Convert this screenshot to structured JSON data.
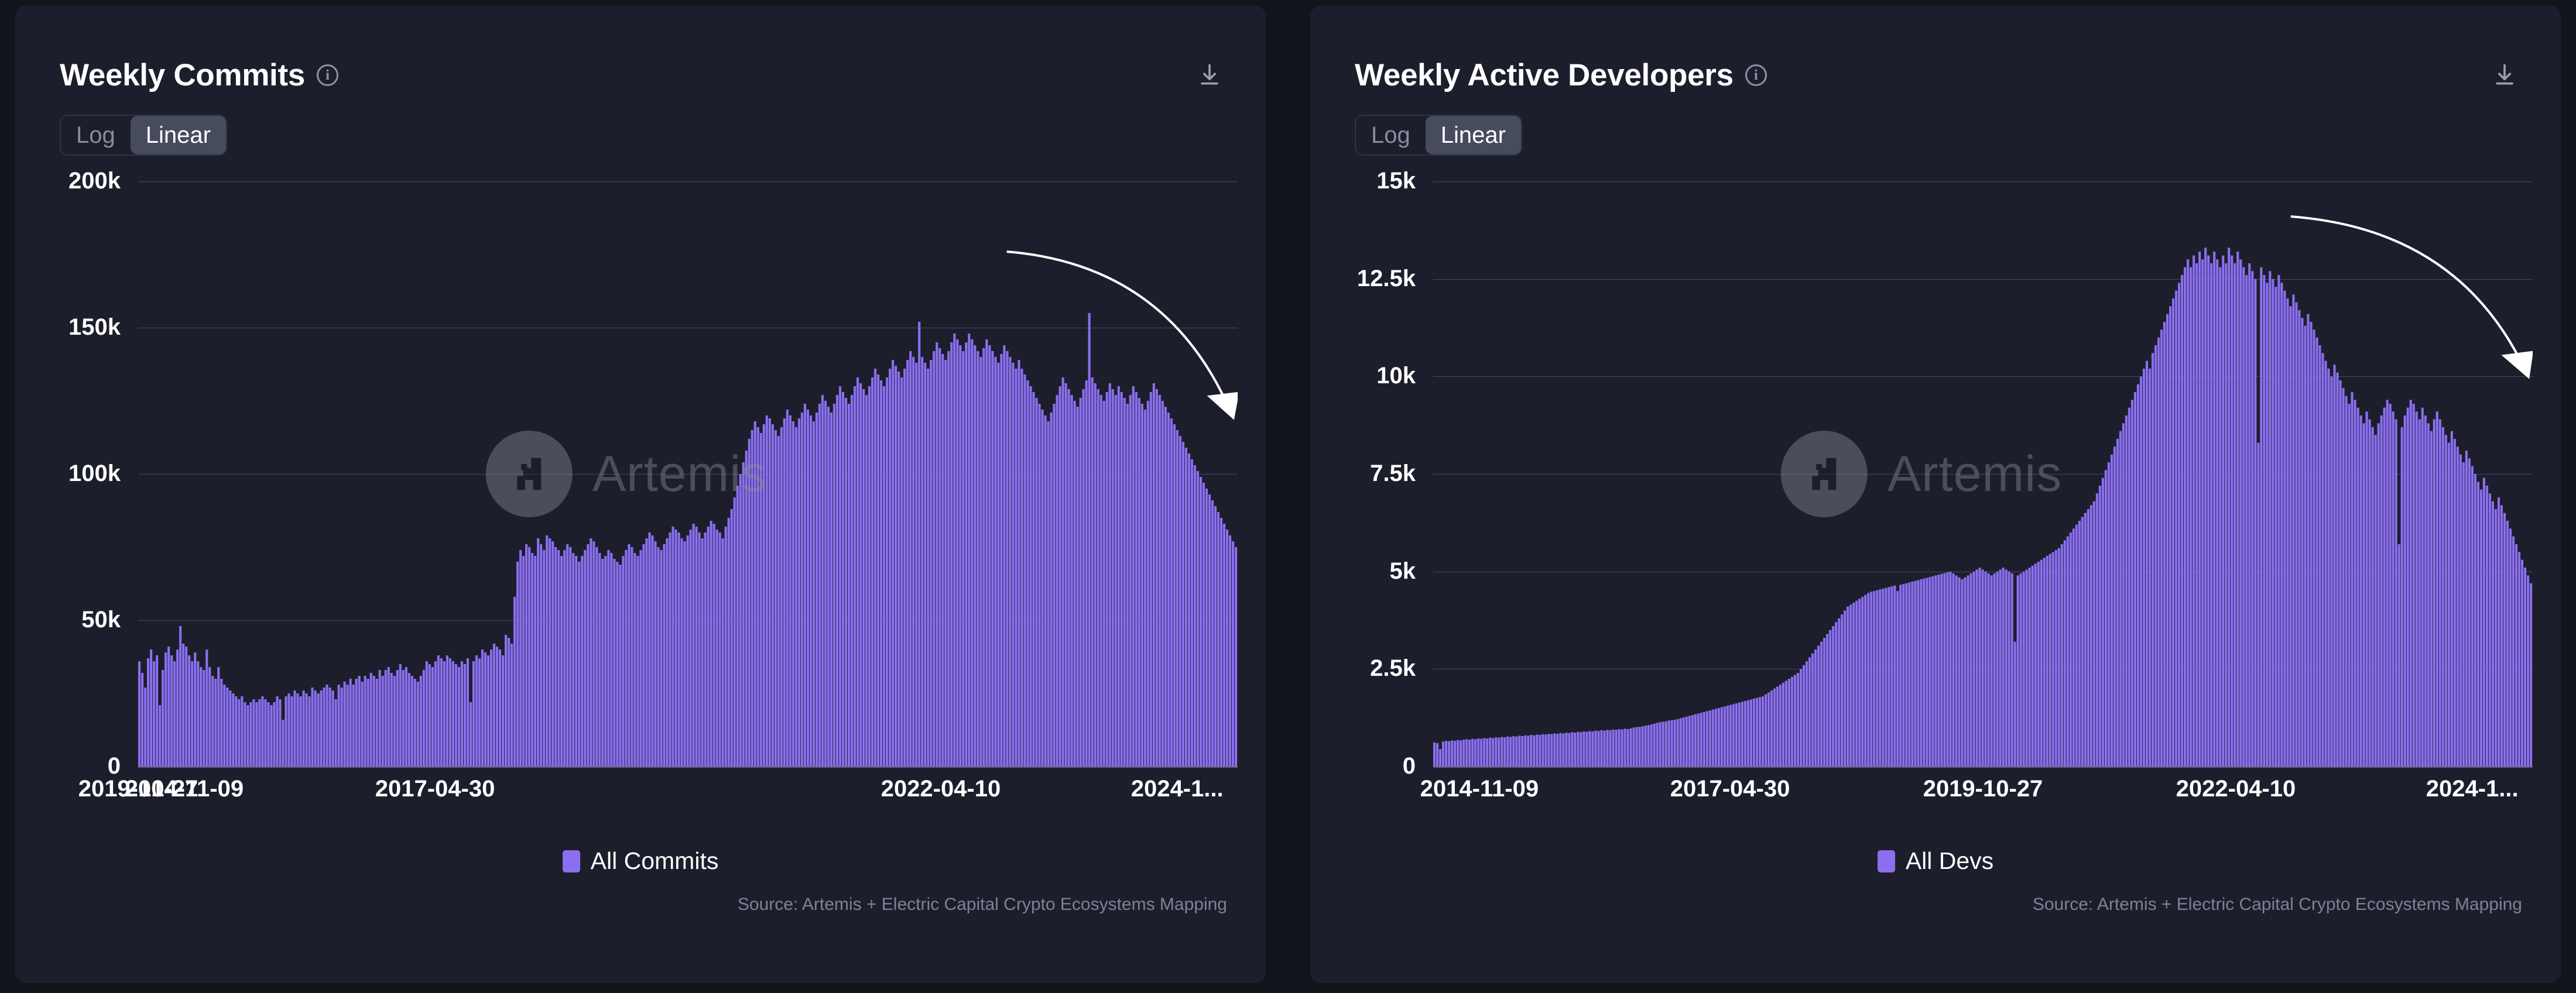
{
  "theme": {
    "page_bg": "#12141c",
    "panel_bg": "#1c1f2b",
    "bar_color": "#8b6ff0",
    "grid_color": "#434a5e",
    "text_primary": "#ffffff",
    "text_muted": "#868d9e",
    "annotation_color": "#ffffff"
  },
  "panels": [
    {
      "title": "Weekly Commits",
      "info_icon": "info-icon",
      "download_icon": "download-icon",
      "scale_toggle": {
        "options": [
          "Log",
          "Linear"
        ],
        "selected": "Linear"
      },
      "watermark": {
        "text": "Artemis",
        "logo": "artemis-logo-icon"
      },
      "legend": [
        {
          "label": "All Commits",
          "color": "#8b6ff0"
        }
      ],
      "source": "Source: Artemis + Electric Capital Crypto Ecosystems Mapping"
    },
    {
      "title": "Weekly Active Developers",
      "info_icon": "info-icon",
      "download_icon": "download-icon",
      "scale_toggle": {
        "options": [
          "Log",
          "Linear"
        ],
        "selected": "Linear"
      },
      "watermark": {
        "text": "Artemis",
        "logo": "artemis-logo-icon"
      },
      "legend": [
        {
          "label": "All Devs",
          "color": "#8b6ff0"
        }
      ],
      "source": "Source: Artemis + Electric Capital Crypto Ecosystems Mapping"
    }
  ],
  "chart_data": [
    {
      "type": "bar",
      "title": "Weekly Commits",
      "xlabel": "",
      "ylabel": "",
      "scale": "linear",
      "grid": true,
      "legend_position": "bottom",
      "series": [
        {
          "name": "All Commits",
          "color": "#8b6ff0"
        }
      ],
      "ylim": [
        0,
        200000
      ],
      "yticks": [
        0,
        50000,
        100000,
        150000,
        200000
      ],
      "ytick_labels": [
        "0",
        "50k",
        "100k",
        "150k",
        "200k"
      ],
      "xticks": [
        "2014-11-09",
        "2017-04-30",
        "2019-10-27",
        "2022-04-10",
        "2024-1..."
      ],
      "xtick_positions_pct": [
        0,
        25.0,
        50.0,
        75.0,
        98.0
      ],
      "x_start": "2014-11-09",
      "x_end": "2024-1...",
      "annotation": {
        "type": "curved-arrow",
        "from_pct": [
          79,
          12
        ],
        "to_pct": [
          99.5,
          40
        ]
      },
      "values": [
        36000,
        32000,
        27000,
        37000,
        40000,
        36000,
        38000,
        21000,
        33000,
        39000,
        41000,
        38000,
        36000,
        40000,
        48000,
        42000,
        41000,
        38000,
        36000,
        39000,
        36000,
        34000,
        33000,
        40000,
        34000,
        31000,
        30000,
        34000,
        30000,
        28000,
        27000,
        26000,
        25000,
        24000,
        23000,
        24000,
        22000,
        21000,
        22000,
        23000,
        22000,
        23000,
        24000,
        23000,
        22000,
        21000,
        22000,
        24000,
        23000,
        16000,
        24000,
        25000,
        24000,
        26000,
        25000,
        24000,
        26000,
        25000,
        24000,
        27000,
        26000,
        25000,
        26000,
        27000,
        28000,
        27000,
        26000,
        23000,
        28000,
        27000,
        29000,
        28000,
        30000,
        28000,
        30000,
        31000,
        29000,
        31000,
        30000,
        32000,
        31000,
        30000,
        33000,
        31000,
        33000,
        34000,
        32000,
        31000,
        33000,
        35000,
        33000,
        34000,
        32000,
        31000,
        30000,
        29000,
        31000,
        33000,
        36000,
        35000,
        34000,
        36000,
        38000,
        37000,
        36000,
        38000,
        37000,
        36000,
        35000,
        34000,
        36000,
        35000,
        37000,
        22000,
        36000,
        38000,
        37000,
        40000,
        39000,
        38000,
        40000,
        42000,
        41000,
        40000,
        38000,
        45000,
        44000,
        42000,
        58000,
        70000,
        74000,
        72000,
        76000,
        75000,
        73000,
        72000,
        78000,
        76000,
        74000,
        79000,
        78000,
        77000,
        75000,
        74000,
        72000,
        74000,
        76000,
        75000,
        73000,
        72000,
        70000,
        72000,
        74000,
        76000,
        78000,
        77000,
        75000,
        73000,
        71000,
        72000,
        74000,
        73000,
        71000,
        70000,
        69000,
        72000,
        74000,
        76000,
        75000,
        73000,
        72000,
        74000,
        76000,
        78000,
        80000,
        79000,
        77000,
        75000,
        74000,
        76000,
        78000,
        80000,
        82000,
        81000,
        80000,
        78000,
        77000,
        79000,
        81000,
        83000,
        82000,
        80000,
        78000,
        80000,
        82000,
        84000,
        83000,
        81000,
        80000,
        78000,
        82000,
        85000,
        88000,
        92000,
        96000,
        100000,
        104000,
        108000,
        112000,
        115000,
        118000,
        116000,
        114000,
        117000,
        120000,
        119000,
        117000,
        115000,
        113000,
        116000,
        119000,
        122000,
        120000,
        118000,
        116000,
        119000,
        121000,
        124000,
        122000,
        120000,
        118000,
        121000,
        124000,
        127000,
        125000,
        123000,
        121000,
        124000,
        127000,
        130000,
        128000,
        126000,
        124000,
        127000,
        130000,
        133000,
        131000,
        129000,
        127000,
        130000,
        133000,
        136000,
        134000,
        132000,
        130000,
        133000,
        136000,
        139000,
        137000,
        135000,
        133000,
        136000,
        139000,
        142000,
        140000,
        138000,
        152000,
        140000,
        138000,
        136000,
        139000,
        142000,
        145000,
        143000,
        141000,
        139000,
        142000,
        145000,
        148000,
        146000,
        144000,
        142000,
        145000,
        148000,
        146000,
        144000,
        142000,
        140000,
        143000,
        146000,
        144000,
        142000,
        140000,
        138000,
        141000,
        144000,
        142000,
        140000,
        138000,
        136000,
        139000,
        136000,
        134000,
        132000,
        130000,
        128000,
        126000,
        124000,
        122000,
        120000,
        118000,
        121000,
        124000,
        127000,
        130000,
        133000,
        131000,
        129000,
        127000,
        125000,
        123000,
        126000,
        129000,
        132000,
        155000,
        133000,
        131000,
        129000,
        127000,
        125000,
        128000,
        131000,
        129000,
        127000,
        130000,
        128000,
        126000,
        124000,
        127000,
        130000,
        128000,
        126000,
        124000,
        122000,
        125000,
        128000,
        131000,
        129000,
        127000,
        125000,
        123000,
        121000,
        119000,
        117000,
        115000,
        113000,
        111000,
        109000,
        107000,
        105000,
        103000,
        101000,
        99000,
        97000,
        95000,
        93000,
        91000,
        89000,
        87000,
        85000,
        83000,
        81000,
        79000,
        77000,
        75000
      ]
    },
    {
      "type": "bar",
      "title": "Weekly Active Developers",
      "xlabel": "",
      "ylabel": "",
      "scale": "linear",
      "grid": true,
      "legend_position": "bottom",
      "series": [
        {
          "name": "All Devs",
          "color": "#8b6ff0"
        }
      ],
      "ylim": [
        0,
        15000
      ],
      "yticks": [
        0,
        2500,
        5000,
        7500,
        10000,
        12500,
        15000
      ],
      "ytick_labels": [
        "0",
        "2.5k",
        "5k",
        "7.5k",
        "10k",
        "12.5k",
        "15k"
      ],
      "xticks": [
        "2014-11-09",
        "2017-04-30",
        "2019-10-27",
        "2022-04-10",
        "2024-1..."
      ],
      "xtick_positions_pct": [
        0,
        25.0,
        50.0,
        75.0,
        98.0
      ],
      "x_start": "2014-11-09",
      "x_end": "2024-1...",
      "annotation": {
        "type": "curved-arrow",
        "from_pct": [
          78,
          6
        ],
        "to_pct": [
          99.5,
          33
        ]
      },
      "values": [
        620,
        600,
        450,
        640,
        660,
        650,
        670,
        660,
        680,
        670,
        690,
        700,
        690,
        710,
        700,
        720,
        710,
        730,
        720,
        740,
        730,
        750,
        740,
        760,
        750,
        770,
        760,
        780,
        770,
        790,
        780,
        800,
        790,
        810,
        800,
        820,
        810,
        830,
        820,
        840,
        830,
        850,
        840,
        860,
        850,
        870,
        860,
        880,
        870,
        890,
        880,
        900,
        890,
        910,
        900,
        920,
        910,
        930,
        920,
        940,
        930,
        950,
        940,
        960,
        950,
        970,
        960,
        980,
        1000,
        1010,
        1020,
        1030,
        1050,
        1060,
        1080,
        1100,
        1120,
        1140,
        1150,
        1160,
        1180,
        1190,
        1200,
        1220,
        1240,
        1260,
        1280,
        1300,
        1320,
        1340,
        1360,
        1380,
        1400,
        1420,
        1440,
        1460,
        1480,
        1500,
        1520,
        1540,
        1560,
        1580,
        1600,
        1620,
        1640,
        1660,
        1680,
        1700,
        1720,
        1740,
        1760,
        1780,
        1800,
        1850,
        1900,
        1950,
        2000,
        2050,
        2100,
        2150,
        2200,
        2250,
        2300,
        2350,
        2400,
        2500,
        2600,
        2700,
        2800,
        2900,
        3000,
        3100,
        3200,
        3300,
        3400,
        3500,
        3600,
        3700,
        3800,
        3900,
        4000,
        4100,
        4150,
        4200,
        4250,
        4300,
        4350,
        4400,
        4450,
        4480,
        4500,
        4520,
        4540,
        4560,
        4580,
        4600,
        4620,
        4640,
        4500,
        4660,
        4680,
        4700,
        4720,
        4740,
        4760,
        4780,
        4800,
        4820,
        4840,
        4860,
        4880,
        4900,
        4920,
        4940,
        4960,
        4980,
        5000,
        4950,
        4900,
        4850,
        4800,
        4850,
        4900,
        4950,
        5000,
        5050,
        5100,
        5050,
        5000,
        4950,
        4900,
        4950,
        5000,
        5050,
        5100,
        5050,
        5000,
        4950,
        3200,
        4900,
        4950,
        5000,
        5050,
        5100,
        5150,
        5200,
        5250,
        5300,
        5350,
        5400,
        5450,
        5500,
        5550,
        5600,
        5700,
        5800,
        5900,
        6000,
        6100,
        6200,
        6300,
        6400,
        6500,
        6600,
        6700,
        6800,
        7000,
        7200,
        7400,
        7600,
        7800,
        8000,
        8200,
        8400,
        8600,
        8800,
        9000,
        9200,
        9400,
        9600,
        9800,
        10000,
        10200,
        10400,
        10200,
        10600,
        10800,
        11000,
        11200,
        11400,
        11600,
        11800,
        12000,
        12200,
        12400,
        12600,
        12800,
        13000,
        12800,
        13100,
        12900,
        13200,
        13000,
        13300,
        13100,
        12900,
        13200,
        13000,
        12800,
        13100,
        12900,
        13300,
        13100,
        12900,
        13200,
        13000,
        12800,
        12600,
        12900,
        12700,
        12500,
        8300,
        12800,
        12600,
        12400,
        12700,
        12500,
        12300,
        12600,
        12400,
        12200,
        12000,
        11800,
        12100,
        11900,
        11700,
        11500,
        11300,
        11600,
        11400,
        11200,
        11000,
        10800,
        10600,
        10400,
        10200,
        10000,
        10300,
        10100,
        9900,
        9700,
        9500,
        9300,
        9600,
        9400,
        9200,
        9000,
        8800,
        9100,
        8900,
        8700,
        8500,
        8800,
        9000,
        9200,
        9400,
        9300,
        9100,
        8900,
        5700,
        8700,
        9000,
        9200,
        9400,
        9300,
        9100,
        8900,
        9200,
        9000,
        8800,
        8600,
        8900,
        9100,
        8900,
        8700,
        8500,
        8300,
        8600,
        8400,
        8200,
        8000,
        7800,
        8100,
        7900,
        7700,
        7500,
        7300,
        7100,
        7400,
        7200,
        7000,
        6800,
        6600,
        6900,
        6700,
        6500,
        6300,
        6100,
        5900,
        5700,
        5500,
        5300,
        5100,
        4900,
        4700
      ]
    }
  ]
}
